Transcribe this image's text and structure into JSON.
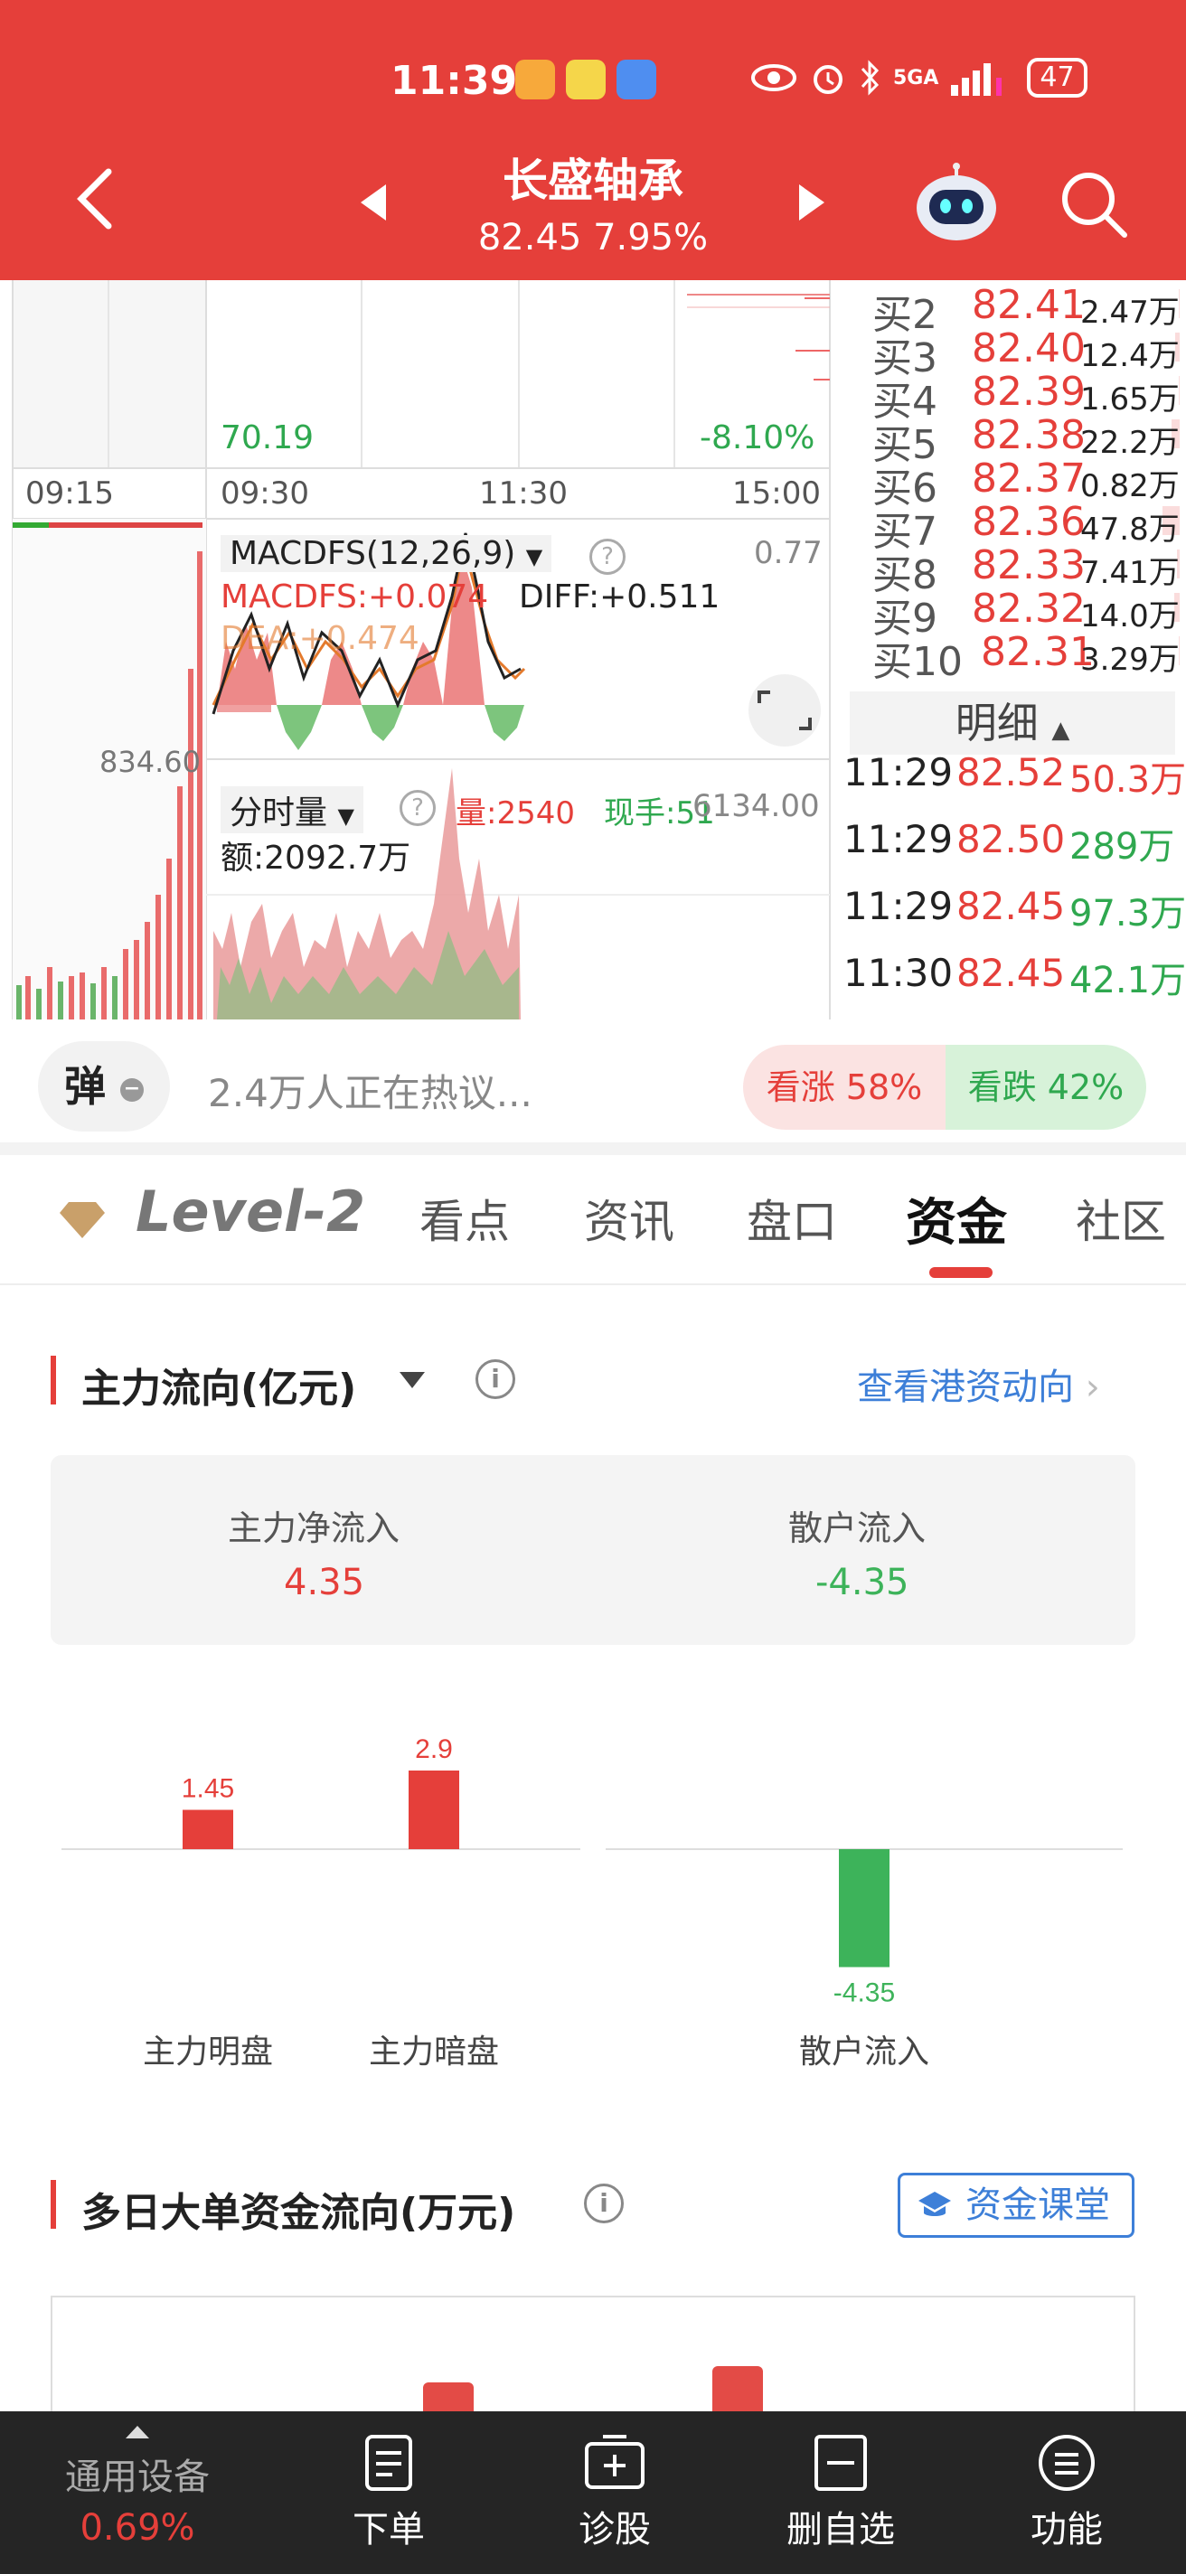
{
  "status_bar": {
    "time": "11:39",
    "network": "5GA",
    "battery": "47"
  },
  "header": {
    "stock_name": "长盛轴承",
    "price_change": "82.45 7.95%"
  },
  "chart": {
    "left_value": "70.19",
    "right_pct": "-8.10%",
    "times": [
      "09:15",
      "09:30",
      "11:30",
      "15:00"
    ],
    "macd_selector": "MACDFS(12,26,9)",
    "macd_value": "MACDFS:+0.074",
    "diff_value": "DIFF:+0.511",
    "dea_value": "DEA:+0.474",
    "macd_right": "0.77",
    "left_price": "834.60",
    "volume_selector": "分时量",
    "volume_value": "量:2540",
    "current_hand": "现手:51",
    "amount": "额:2092.7万",
    "volume_right": "6134.00"
  },
  "order_book": {
    "buys": [
      {
        "label": "买2",
        "price": "82.41",
        "volume": "2.47万",
        "frac": 0.04
      },
      {
        "label": "买3",
        "price": "82.40",
        "volume": "12.4万",
        "frac": 0.22
      },
      {
        "label": "买4",
        "price": "82.39",
        "volume": "1.65万",
        "frac": 0.03
      },
      {
        "label": "买5",
        "price": "82.38",
        "volume": "22.2万",
        "frac": 0.4
      },
      {
        "label": "买6",
        "price": "82.37",
        "volume": "0.82万",
        "frac": 0.02
      },
      {
        "label": "买7",
        "price": "82.36",
        "volume": "47.8万",
        "frac": 0.86
      },
      {
        "label": "买8",
        "price": "82.33",
        "volume": "7.41万",
        "frac": 0.13
      },
      {
        "label": "买9",
        "price": "82.32",
        "volume": "14.0万",
        "frac": 0.25
      },
      {
        "label": "买10",
        "price": "82.31",
        "volume": "3.29万",
        "frac": 0.06
      }
    ],
    "detail_header": "明细",
    "trades": [
      {
        "time": "11:29",
        "price": "82.52",
        "volume": "50.3万"
      },
      {
        "time": "11:29",
        "price": "82.50",
        "volume": "289万"
      },
      {
        "time": "11:29",
        "price": "82.45",
        "volume": "97.3万"
      },
      {
        "time": "11:30",
        "price": "82.45",
        "volume": "42.1万"
      }
    ]
  },
  "comment": {
    "danmu_label": "弹",
    "hot_text": "2.4万人正在热议...",
    "vote_up": "看涨 58%",
    "vote_down": "看跌 42%"
  },
  "tabs": {
    "level2": "Level-2",
    "items": [
      "看点",
      "资讯",
      "盘口",
      "资金",
      "社区"
    ],
    "active": "资金"
  },
  "main_flow": {
    "title": "主力流向(亿元)",
    "link": "查看港资动向",
    "net_in_label": "主力净流入",
    "net_in_value": "4.35",
    "retail_label": "散户流入",
    "retail_value": "-4.35",
    "colors": {
      "up": "#e53f3a",
      "down": "#3db35a"
    }
  },
  "chart_data": {
    "type": "bar",
    "categories": [
      "主力明盘",
      "主力暗盘",
      "散户流入"
    ],
    "values": [
      1.45,
      2.9,
      -4.35
    ],
    "value_labels": [
      "1.45",
      "2.9",
      "-4.35"
    ]
  },
  "multi_day": {
    "title": "多日大单资金流向(万元)",
    "course_button": "资金课堂"
  },
  "bottom_bar": {
    "index_name": "通用设备",
    "index_pct": "0.69%",
    "order": "下单",
    "diagnose": "诊股",
    "remove_watch": "删自选",
    "functions": "功能"
  }
}
